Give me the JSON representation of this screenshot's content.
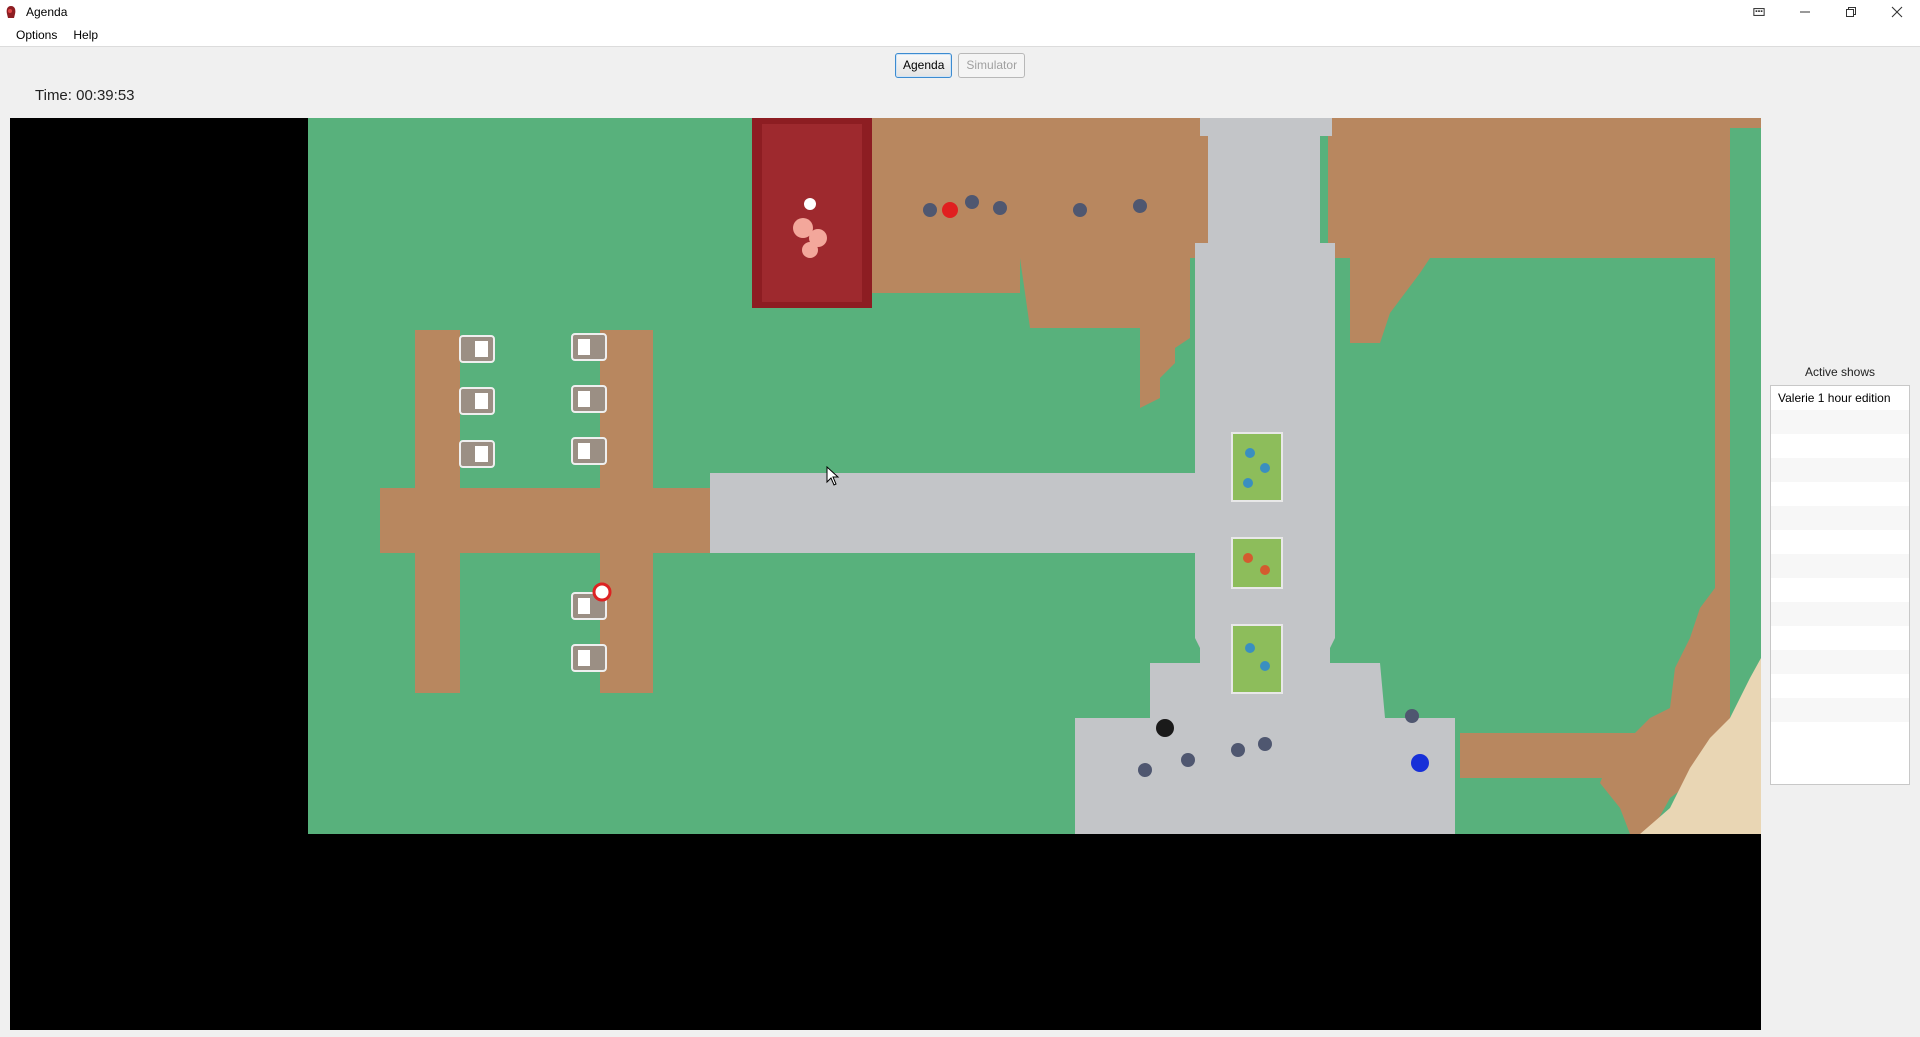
{
  "window": {
    "title": "Agenda"
  },
  "menu": {
    "options": "Options",
    "help": "Help"
  },
  "tabs": {
    "agenda": "Agenda",
    "simulator": "Simulator"
  },
  "status": {
    "time": "Time: 00:39:53"
  },
  "active_shows": {
    "title": "Active shows",
    "items": [
      "Valerie 1 hour edition",
      "",
      "",
      "",
      "",
      "",
      "",
      "",
      "",
      "",
      "",
      "",
      "",
      ""
    ]
  },
  "colors": {
    "grass": "#58b17c",
    "dirt": "#b8875f",
    "stone": "#c3c5c8",
    "sand": "#e9d6b4",
    "stage_red": "#8d1d22",
    "viewport_bg": "#000000",
    "tab_focus": "#3c8bd0"
  }
}
